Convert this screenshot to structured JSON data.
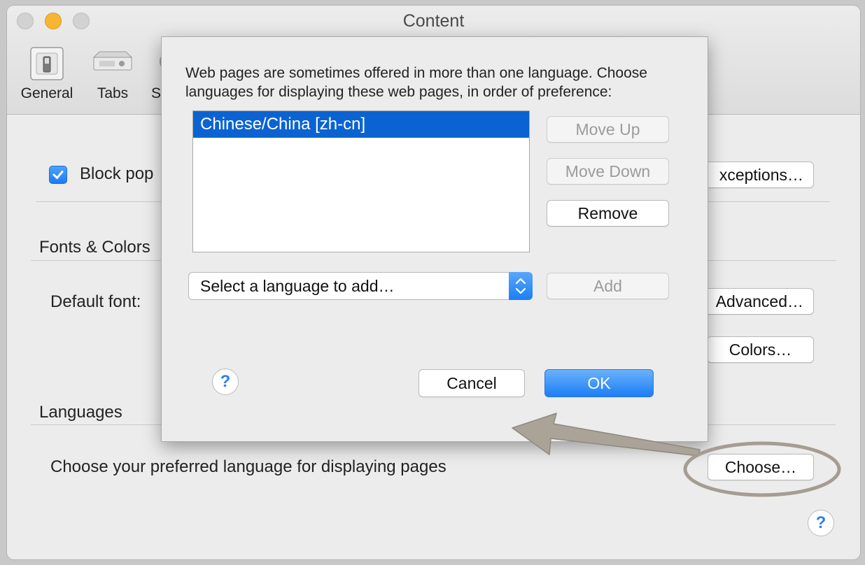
{
  "window": {
    "title": "Content",
    "toolbar": [
      {
        "label": "General",
        "icon": "general-switch-icon"
      },
      {
        "label": "Tabs",
        "icon": "tabs-icon"
      },
      {
        "label": "S",
        "icon": "partial-toolbar-icon"
      }
    ]
  },
  "prefs": {
    "block_popups_label": "Block pop",
    "block_popups_checked": true,
    "exceptions_button": "xceptions…",
    "fonts_colors_heading": "Fonts & Colors",
    "default_font_label": "Default font:",
    "advanced_button": "Advanced…",
    "colors_button": "Colors…",
    "languages_heading": "Languages",
    "languages_desc": "Choose your preferred language for displaying pages",
    "choose_button": "Choose…",
    "help": "?"
  },
  "sheet": {
    "description": "Web pages are sometimes offered in more than one language. Choose languages for displaying these web pages, in order of preference:",
    "languages": [
      "Chinese/China  [zh-cn]"
    ],
    "move_up": "Move Up",
    "move_down": "Move Down",
    "remove": "Remove",
    "select_placeholder": "Select a language to add…",
    "add": "Add",
    "help": "?",
    "cancel": "Cancel",
    "ok": "OK"
  },
  "colors": {
    "accent": "#1c7ef5",
    "selection": "#0b63d1",
    "traffic_close": "#d0d0d0",
    "traffic_min": "#f6b631",
    "traffic_zoom": "#d0d0d0",
    "annotation": "#a59d92"
  }
}
